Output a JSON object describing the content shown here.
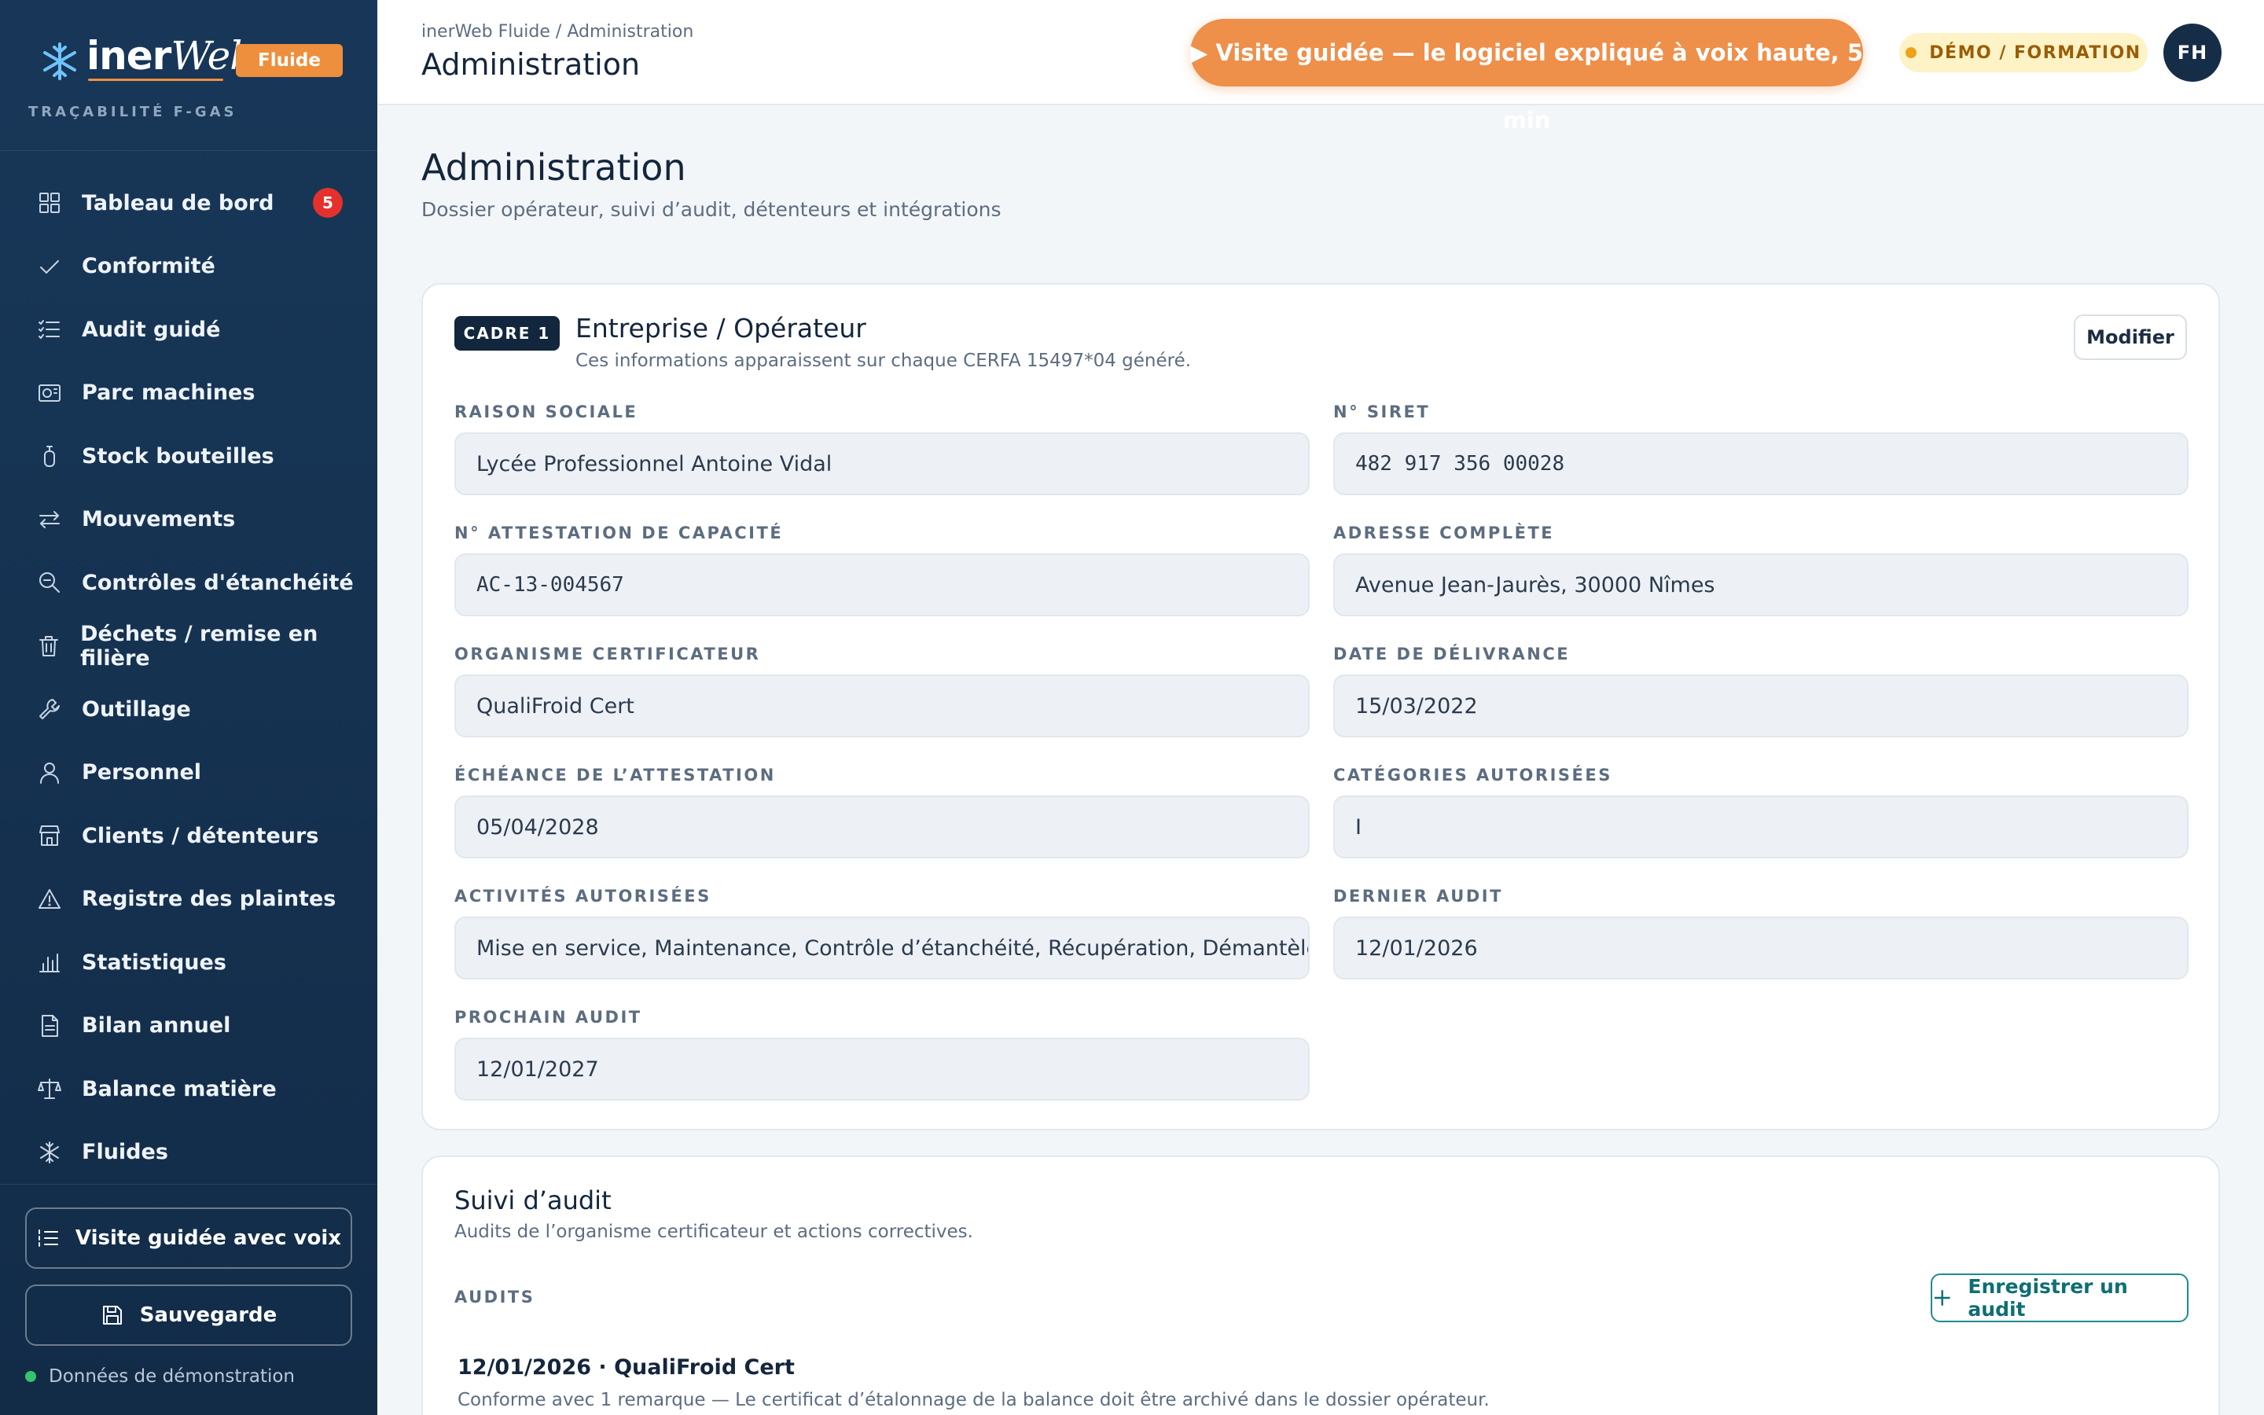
{
  "sidebar": {
    "logo_main": "iner",
    "logo_accent": "Web",
    "brand_pill": "Fluide",
    "brand_sub": "TRAÇABILITÉ F-GAS",
    "items": [
      {
        "label": "Tableau de bord",
        "icon": "dashboard-icon",
        "badge": "5"
      },
      {
        "label": "Conformité",
        "icon": "check-icon"
      },
      {
        "label": "Audit guidé",
        "icon": "checklist-icon"
      },
      {
        "label": "Parc machines",
        "icon": "machine-icon"
      },
      {
        "label": "Stock bouteilles",
        "icon": "bottle-icon"
      },
      {
        "label": "Mouvements",
        "icon": "arrows-icon"
      },
      {
        "label": "Contrôles d'étanchéité",
        "icon": "magnifier-icon"
      },
      {
        "label": "Déchets / remise en filière",
        "icon": "trash-icon"
      },
      {
        "label": "Outillage",
        "icon": "wrench-icon"
      },
      {
        "label": "Personnel",
        "icon": "user-icon"
      },
      {
        "label": "Clients / détenteurs",
        "icon": "store-icon"
      },
      {
        "label": "Registre des plaintes",
        "icon": "warning-icon"
      },
      {
        "label": "Statistiques",
        "icon": "bar-chart-icon"
      },
      {
        "label": "Bilan annuel",
        "icon": "document-icon"
      },
      {
        "label": "Balance matière",
        "icon": "scale-icon"
      },
      {
        "label": "Fluides",
        "icon": "snowflake-icon"
      }
    ],
    "guided_tour_label": "Visite guidée avec voix",
    "backup_label": "Sauvegarde",
    "demo_data_label": "Données de démonstration"
  },
  "topbar": {
    "breadcrumb": "inerWeb Fluide / Administration",
    "title": "Administration",
    "guide_button": "▶ Visite guidée — le logiciel expliqué à voix haute, 5 min",
    "demo_badge": "DÉMO / FORMATION",
    "avatar_initials": "FH"
  },
  "page": {
    "title": "Administration",
    "subtitle": "Dossier opérateur, suivi d’audit, détenteurs et intégrations"
  },
  "operator_card": {
    "cadre": "CADRE 1",
    "title": "Entreprise / Opérateur",
    "subtitle": "Ces informations apparaissent sur chaque CERFA 15497*04 généré.",
    "edit_label": "Modifier",
    "fields": {
      "raison_sociale": {
        "label": "RAISON SOCIALE",
        "value": "Lycée Professionnel Antoine Vidal"
      },
      "siret": {
        "label": "N° SIRET",
        "value": "482 917 356 00028"
      },
      "attestation": {
        "label": "N° ATTESTATION DE CAPACITÉ",
        "value": "AC-13-004567"
      },
      "adresse": {
        "label": "ADRESSE COMPLÈTE",
        "value": "Avenue Jean-Jaurès, 30000 Nîmes"
      },
      "organisme": {
        "label": "ORGANISME CERTIFICATEUR",
        "value": "QualiFroid Cert"
      },
      "date_delivrance": {
        "label": "DATE DE DÉLIVRANCE",
        "value": "15/03/2022"
      },
      "echeance": {
        "label": "ÉCHÉANCE DE L’ATTESTATION",
        "value": "05/04/2028"
      },
      "categories": {
        "label": "CATÉGORIES AUTORISÉES",
        "value": "I"
      },
      "activites": {
        "label": "ACTIVITÉS AUTORISÉES",
        "value": "Mise en service, Maintenance, Contrôle d’étanchéité, Récupération, Démantèlement"
      },
      "dernier_audit": {
        "label": "DERNIER AUDIT",
        "value": "12/01/2026"
      },
      "prochain_audit": {
        "label": "PROCHAIN AUDIT",
        "value": "12/01/2027"
      }
    }
  },
  "audit_card": {
    "title": "Suivi d’audit",
    "subtitle": "Audits de l’organisme certificateur et actions correctives.",
    "section_label": "AUDITS",
    "add_button": "Enregistrer un audit",
    "entries": [
      {
        "title": "12/01/2026 · QualiFroid Cert",
        "text": "Conforme avec 1 remarque — Le certificat d’étalonnage de la balance doit être archivé dans le dossier opérateur."
      }
    ]
  },
  "colors": {
    "sidebar_bg": "#163452",
    "accent_orange": "#ee8f4a",
    "badge_red": "#e5312d",
    "teal": "#0f6e74"
  }
}
